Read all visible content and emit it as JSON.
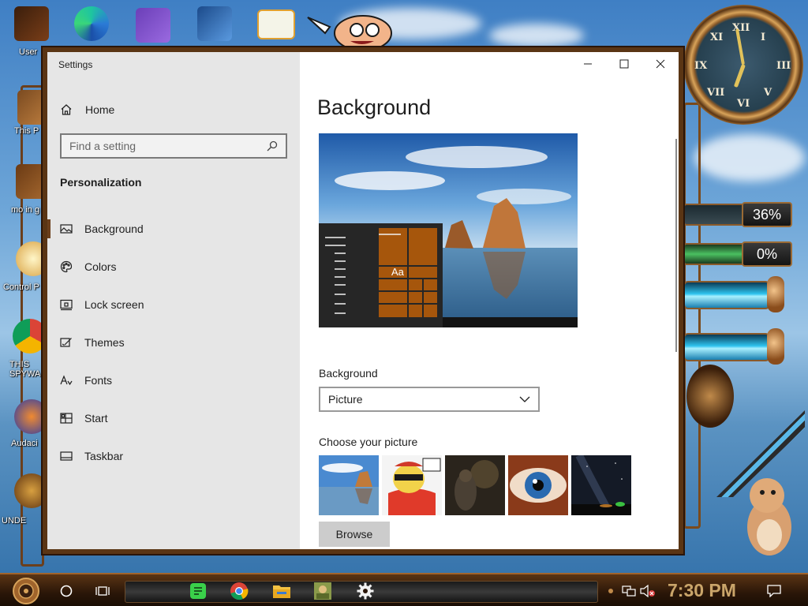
{
  "desktop": {
    "icons": [
      {
        "label": "User"
      },
      {
        "label": "This P"
      },
      {
        "label": "mo in g"
      },
      {
        "label": "Control P"
      },
      {
        "label": "THIS SPYWA"
      },
      {
        "label": "Audaci"
      },
      {
        "label": "UNDE"
      }
    ],
    "gauges": [
      {
        "value": "36%"
      },
      {
        "value": "0%"
      }
    ]
  },
  "window": {
    "app_title": "Settings",
    "controls": {
      "minimize": "minimize",
      "maximize": "maximize",
      "close": "close"
    }
  },
  "sidebar": {
    "home_label": "Home",
    "search_placeholder": "Find a setting",
    "section_title": "Personalization",
    "items": [
      {
        "label": "Background",
        "icon": "picture-icon",
        "active": true
      },
      {
        "label": "Colors",
        "icon": "palette-icon"
      },
      {
        "label": "Lock screen",
        "icon": "lock-screen-icon"
      },
      {
        "label": "Themes",
        "icon": "themes-icon"
      },
      {
        "label": "Fonts",
        "icon": "fonts-icon"
      },
      {
        "label": "Start",
        "icon": "start-icon"
      },
      {
        "label": "Taskbar",
        "icon": "taskbar-icon"
      }
    ]
  },
  "main": {
    "title": "Background",
    "preview": {
      "sample_text": "Aa"
    },
    "background_label": "Background",
    "background_value": "Picture",
    "choose_label": "Choose your picture",
    "browse_label": "Browse"
  },
  "taskbar": {
    "time": "7:30 PM"
  }
}
